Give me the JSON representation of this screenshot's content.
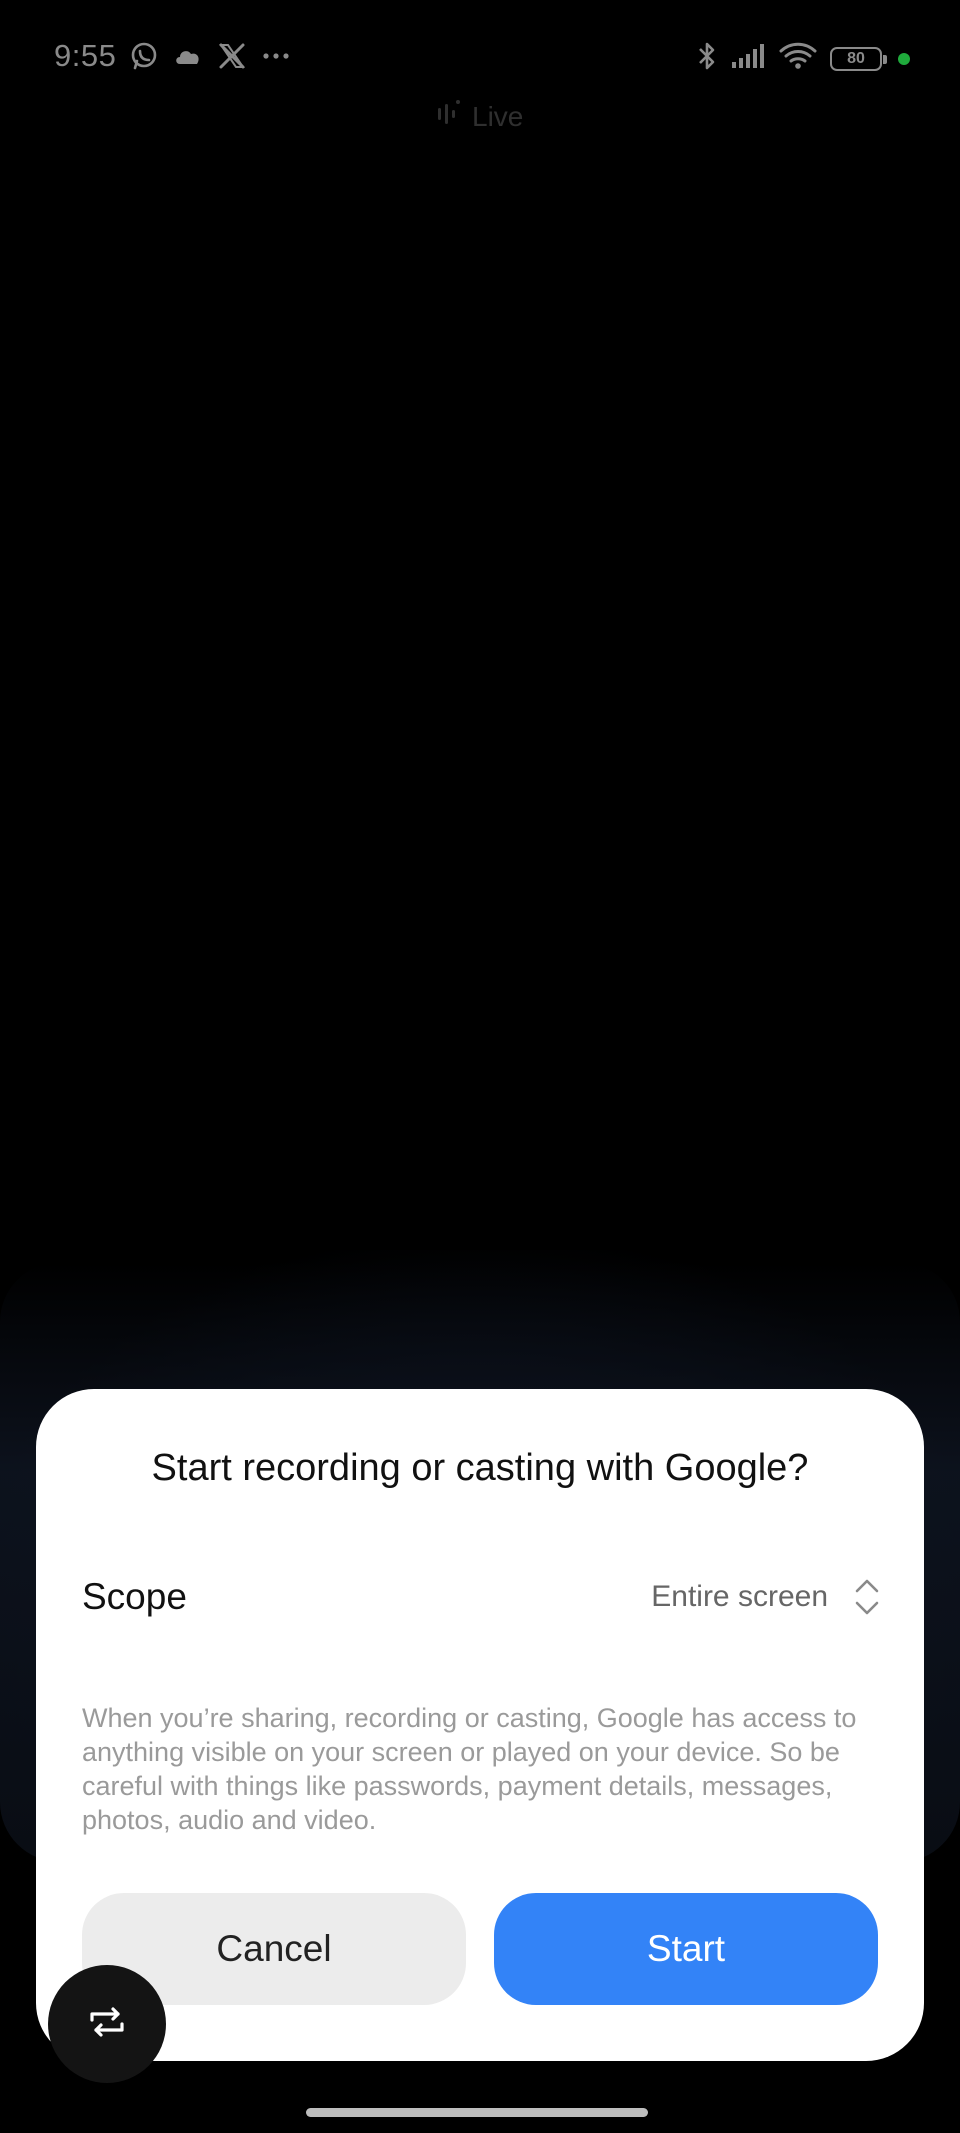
{
  "status_bar": {
    "time": "9:55",
    "left_icons": [
      "whatsapp-icon",
      "cloud-icon",
      "x-icon",
      "more-notifications-icon"
    ],
    "right_icons": [
      "bluetooth-icon",
      "cellular-signal-icon",
      "wifi-icon",
      "battery-icon"
    ],
    "battery_level": "80",
    "privacy_indicator_color": "#1faa3c"
  },
  "live_indicator": {
    "label": "Live",
    "icon": "audio-waveform-icon"
  },
  "dialog": {
    "title": "Start recording or casting with Google?",
    "scope_label": "Scope",
    "scope_value": "Entire screen",
    "scope_icon": "expand-chevrons-icon",
    "disclaimer": "When you’re sharing, recording or casting, Google has access to anything visible on your screen or played on your device. So be careful with things like passwords, payment details, messages, photos, audio and video.",
    "cancel_label": "Cancel",
    "start_label": "Start"
  },
  "floating_button": {
    "icon": "repeat-icon"
  },
  "colors": {
    "background": "#000000",
    "dialog_background": "#ffffff",
    "primary_button": "#3383f7",
    "secondary_button": "#ececec",
    "disclaimer_text": "#9a9a9a"
  }
}
